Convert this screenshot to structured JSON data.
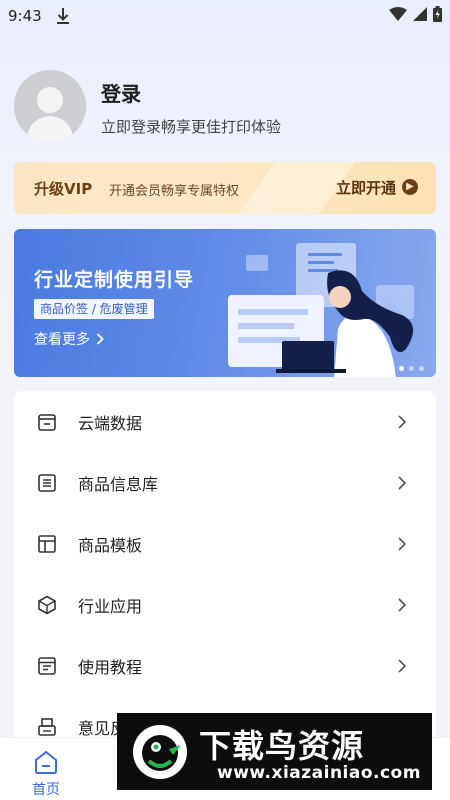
{
  "status_bar": {
    "time": "9:43",
    "icons": [
      "download-icon",
      "wifi-icon",
      "signal-icon",
      "battery-icon"
    ]
  },
  "profile": {
    "title": "登录",
    "subtitle": "立即登录畅享更佳打印体验"
  },
  "vip": {
    "title": "升级VIP",
    "description": "开通会员畅享专属特权",
    "action": "立即开通"
  },
  "banner": {
    "title": "行业定制使用引导",
    "tag": "商品价签 / 危废管理",
    "more": "查看更多",
    "more_icon": "chevron-right-icon",
    "page_count": 3,
    "active_page": 1
  },
  "menu": {
    "items": [
      {
        "label": "云端数据",
        "icon": "cloud-folder-icon"
      },
      {
        "label": "商品信息库",
        "icon": "list-icon"
      },
      {
        "label": "商品模板",
        "icon": "template-layout-icon"
      },
      {
        "label": "行业应用",
        "icon": "cube-icon"
      },
      {
        "label": "使用教程",
        "icon": "tutorial-doc-icon"
      },
      {
        "label": "意见反馈",
        "icon": "feedback-printer-icon"
      }
    ]
  },
  "tabbar": {
    "home_label": "首页",
    "home_icon": "home-icon"
  },
  "watermark": {
    "text": "下载鸟资源",
    "url": "www.xiazainiao.com"
  },
  "colors": {
    "accent": "#3a6be0",
    "vip_text": "#6b3f12",
    "banner_bg": "#4a7be0"
  }
}
